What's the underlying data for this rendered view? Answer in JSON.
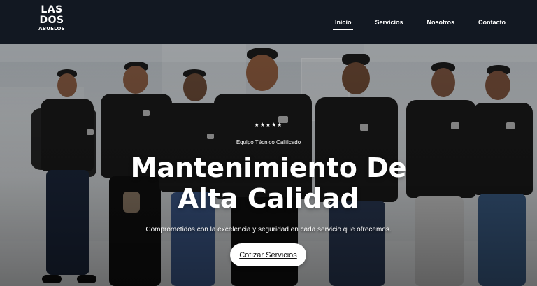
{
  "header": {
    "logo": {
      "line1": "LAS",
      "line2": "DOS",
      "line3": "ABUELOS"
    },
    "nav": [
      {
        "label": "Inicio",
        "active": true
      },
      {
        "label": "Servicios",
        "active": false
      },
      {
        "label": "Nosotros",
        "active": false
      },
      {
        "label": "Contacto",
        "active": false
      }
    ]
  },
  "hero": {
    "stars": "★★★★★",
    "eyebrow": "Equipo  Técnico Calificado",
    "headline_line1": "Mantenimiento De",
    "headline_line2": "Alta Calidad",
    "subtitle": "Comprometidos con la excelencia y seguridad  en   cada servicio que ofrecemos.",
    "cta_label": "Cotizar Servicios"
  },
  "colors": {
    "header_bg": "#121822",
    "white": "#ffffff",
    "shirt": "#1a1a1a"
  }
}
